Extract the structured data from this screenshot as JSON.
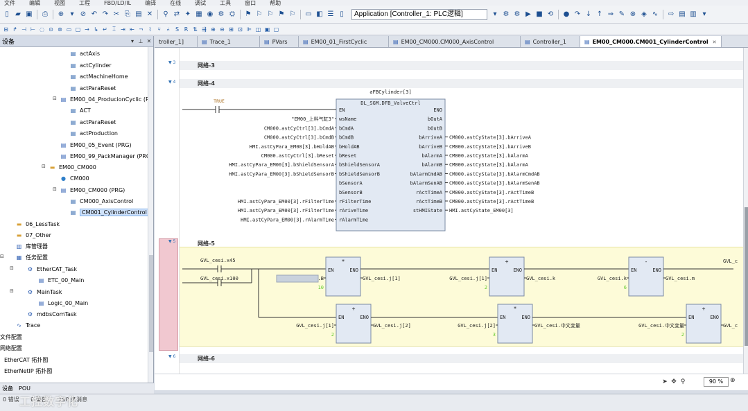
{
  "menu": [
    "文件",
    "编辑",
    "视图",
    "工程",
    "FBD/LD/IL",
    "编译",
    "在线",
    "调试",
    "工具",
    "窗口",
    "帮助"
  ],
  "toolbar": {
    "application_selector": "Application [Controller_1: PLC逻辑]"
  },
  "devices_panel": {
    "title": "设备",
    "items": [
      {
        "label": "actAxis",
        "icon": "action-icon"
      },
      {
        "label": "actCylinder",
        "icon": "action-icon"
      },
      {
        "label": "actMachineHome",
        "icon": "action-icon"
      },
      {
        "label": "actParaReset",
        "icon": "action-icon"
      },
      {
        "label": "EM00_04_ProducionCyclic (PRG)",
        "icon": "program-icon"
      },
      {
        "label": "ACT",
        "icon": "action-icon"
      },
      {
        "label": "actParaReset",
        "icon": "action-icon"
      },
      {
        "label": "actProduction",
        "icon": "action-icon"
      },
      {
        "label": "EM00_05_Event (PRG)",
        "icon": "program-icon"
      },
      {
        "label": "EM00_99_PackManager (PRG)",
        "icon": "program-icon"
      },
      {
        "label": "EM00_CM000",
        "icon": "folder-icon"
      },
      {
        "label": "CM000",
        "icon": "globe-icon"
      },
      {
        "label": "EM00_CM000 (PRG)",
        "icon": "program-icon"
      },
      {
        "label": "CM000_AxisControl",
        "icon": "action-icon"
      },
      {
        "label": "CM001_CylinderControl",
        "icon": "action-icon"
      },
      {
        "label": "06_LessTask",
        "icon": "folder-icon"
      },
      {
        "label": "07_Other",
        "icon": "folder-icon"
      },
      {
        "label": "库管理器",
        "icon": "library-icon"
      },
      {
        "label": "任务配置",
        "icon": "task-config-icon"
      },
      {
        "label": "EtherCAT_Task",
        "icon": "task-icon"
      },
      {
        "label": "ETC_00_Main",
        "icon": "program-icon"
      },
      {
        "label": "MainTask",
        "icon": "task-icon"
      },
      {
        "label": "Logic_00_Main",
        "icon": "program-icon"
      },
      {
        "label": "mdbsComTask",
        "icon": "task-icon"
      },
      {
        "label": "Trace",
        "icon": "trace-icon"
      },
      {
        "label": "文件配置",
        "icon": ""
      },
      {
        "label": "网络配置",
        "icon": ""
      },
      {
        "label": "EtherCAT 拓扑图",
        "icon": ""
      },
      {
        "label": "EtherNetIP 拓扑图",
        "icon": ""
      }
    ],
    "bottom_tabs": [
      "设备",
      "POU"
    ]
  },
  "tabs": [
    {
      "label": "troller_1]",
      "active": false
    },
    {
      "label": "Trace_1",
      "active": false
    },
    {
      "label": "PVars",
      "active": false
    },
    {
      "label": "EM00_01_FirstCyclic",
      "active": false
    },
    {
      "label": "EM00_CM000.CM000_AxisControl",
      "active": false
    },
    {
      "label": "Controller_1",
      "active": false
    },
    {
      "label": "EM00_CM000.CM001_CylinderControl",
      "active": true
    }
  ],
  "editor": {
    "networks": [
      "网络-3",
      "网络-4",
      "网络-5",
      "网络-6"
    ],
    "gutter_marks": [
      "3",
      "4",
      "5",
      "6"
    ],
    "net4": {
      "instance": "aFBCylinder[3]",
      "fb_type": "DL_SGM.DFB_ValveCtrl",
      "contact": "TRUE",
      "inputs": [
        {
          "pin": "EN",
          "var": ""
        },
        {
          "pin": "wsName",
          "var": "\"EM00_上料气缸3\""
        },
        {
          "pin": "bCmdA",
          "var": "CM000.astCyCtrl[3].bCmdA"
        },
        {
          "pin": "bCmdB",
          "var": "CM000.astCyCtrl[3].bCmdB"
        },
        {
          "pin": "bHoldAB",
          "var": "HMI.astCyPara_EM00[3].bHoldAB"
        },
        {
          "pin": "bReset",
          "var": "CM000.astCyCtrl[3].bReset"
        },
        {
          "pin": "bShieldSensorA",
          "var": "HMI.astCyPara_EM00[3].bShieldSensorA"
        },
        {
          "pin": "bShieldSensorB",
          "var": "HMI.astCyPara_EM00[3].bShieldSensorB"
        },
        {
          "pin": "bSensorA",
          "var": ""
        },
        {
          "pin": "bSensorB",
          "var": ""
        },
        {
          "pin": "rFilterTime",
          "var": "HMI.astCyPara_EM00[3].rFilterTime"
        },
        {
          "pin": "rAriveTime",
          "var": "HMI.astCyPara_EM00[3].rFilterTime"
        },
        {
          "pin": "rAlarmTime",
          "var": "HMI.astCyPara_EM00[3].rAlarmTime"
        }
      ],
      "outputs": [
        {
          "pin": "ENO",
          "var": ""
        },
        {
          "pin": "bOutA",
          "var": ""
        },
        {
          "pin": "bOutB",
          "var": ""
        },
        {
          "pin": "bArriveA",
          "var": "CM000.astCyState[3].bArriveA"
        },
        {
          "pin": "bArriveB",
          "var": "CM000.astCyState[3].bArriveB"
        },
        {
          "pin": "bAlarmA",
          "var": "CM000.astCyState[3].bAlarmA"
        },
        {
          "pin": "bAlarmB",
          "var": "CM000.astCyState[3].bAlarmA"
        },
        {
          "pin": "bAlarmCmdAB",
          "var": "CM000.astCyState[3].bAlarmCmdAB"
        },
        {
          "pin": "bAlarmSenAB",
          "var": "CM000.astCyState[3].bAlarmSenAB"
        },
        {
          "pin": "rActTimeA",
          "var": "CM000.astCyState[3].rActTimeB"
        },
        {
          "pin": "rActTimeB",
          "var": "CM000.astCyState[3].rActTimeB"
        },
        {
          "pin": "stHMIState",
          "var": "HMI.astCyState_EM00[3]"
        }
      ]
    },
    "net5": {
      "contacts": [
        "GVL_cesi.x45",
        "GVL_cesi.x100"
      ],
      "row1": [
        {
          "op": "*",
          "in1": "GVL_cesi.B",
          "in2": "10",
          "out": "GVL_cesi.j[1]"
        },
        {
          "op": "+",
          "in1": "GVL_cesi.j[1]",
          "in2": "2",
          "out": "GVL_cesi.k"
        },
        {
          "op": "-",
          "in1": "GVL_cesi.k",
          "in2": "6",
          "out": "GVL_cesi.m"
        }
      ],
      "row1_tail": "GVL_c",
      "row2": [
        {
          "op": "+",
          "in1": "GVL_cesi.j[1]",
          "in2": "2",
          "out": "GVL_cesi.j[2]"
        },
        {
          "op": "*",
          "in1": "GVL_cesi.j[2]",
          "in2": "3",
          "out": "GVL_cesi.中文变量"
        },
        {
          "op": "+",
          "in1": "GVL_cesi.中文变量",
          "in2": "2",
          "out": "GVL_c"
        }
      ],
      "en": "EN",
      "eno": "ENO"
    },
    "zoom": "90 %"
  },
  "status": {
    "line1": [
      "0 错误",
      "0 警告",
      "190 条消息"
    ],
    "watermark": "工控数字化"
  }
}
